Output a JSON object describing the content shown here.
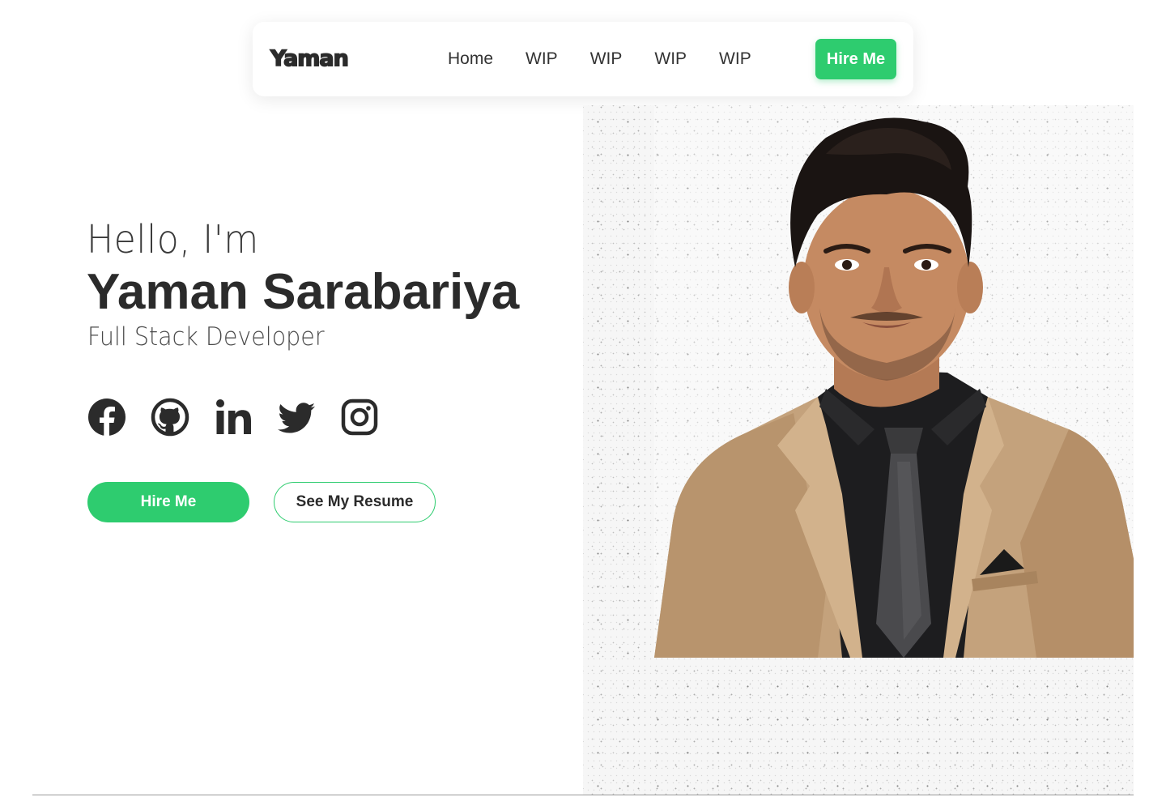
{
  "navbar": {
    "logo": "Yaman",
    "links": [
      {
        "label": "Home"
      },
      {
        "label": "WIP"
      },
      {
        "label": "WIP"
      },
      {
        "label": "WIP"
      },
      {
        "label": "WIP"
      }
    ],
    "cta_label": "Hire Me"
  },
  "hero": {
    "greeting": "Hello, I'm",
    "name": "Yaman Sarabariya",
    "role": "Full Stack Developer",
    "socials": [
      {
        "name": "facebook-icon"
      },
      {
        "name": "github-icon"
      },
      {
        "name": "linkedin-icon"
      },
      {
        "name": "twitter-icon"
      },
      {
        "name": "instagram-icon"
      }
    ],
    "primary_button": "Hire Me",
    "secondary_button": "See My Resume"
  },
  "colors": {
    "accent": "#2ecc6f",
    "text": "#2b2b2b",
    "background": "#ffffff"
  }
}
